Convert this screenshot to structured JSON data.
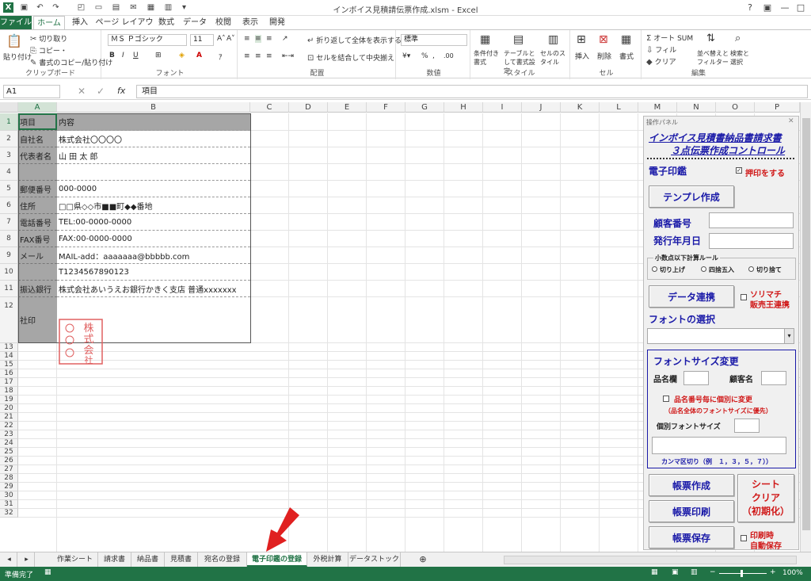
{
  "titlebar": {
    "title": "インボイス見積請伝票作成.xlsm - Excel",
    "help": "?",
    "min": "—",
    "max": "□",
    "close": "✕"
  },
  "tabs": [
    "ファイル",
    "ホーム",
    "挿入",
    "ページ レイアウト",
    "数式",
    "データ",
    "校閲",
    "表示",
    "開発"
  ],
  "ribbon": {
    "clipboard": {
      "paste": "貼り付け",
      "cut": "切り取り",
      "copy": "コピー・",
      "format_painter": "書式のコピー/貼り付け",
      "label": "クリップボード"
    },
    "font": {
      "name": "ＭＳ Ｐゴシック",
      "size": "11",
      "bold": "B",
      "italic": "I",
      "underline": "U",
      "label": "フォント"
    },
    "alignment": {
      "wrap": "折り返して全体を表示する",
      "merge": "セルを結合して中央揃え",
      "label": "配置"
    },
    "number": {
      "format": "標準",
      "percent": "%",
      "comma": ",",
      "label": "数値"
    },
    "styles": {
      "conditional": "条件付き書式",
      "table": "テーブルとして書式設定",
      "cell": "セルのスタイル",
      "label": "スタイル"
    },
    "cells": {
      "insert": "挿入",
      "delete": "削除",
      "format": "書式",
      "label": "セル"
    },
    "editing": {
      "autosum": "オート SUM",
      "fill": "フィル",
      "clear": "クリア",
      "sort": "並べ替えとフィルター",
      "find": "検索と選択",
      "label": "編集"
    }
  },
  "formula_bar": {
    "name_box": "A1",
    "fx": "fx",
    "value": "項目"
  },
  "columns": [
    "A",
    "B",
    "C",
    "D",
    "E",
    "F",
    "G",
    "H",
    "I",
    "J",
    "K",
    "L",
    "M",
    "N",
    "O",
    "P"
  ],
  "rows": [
    "1",
    "2",
    "3",
    "4",
    "5",
    "6",
    "7",
    "8",
    "9",
    "10",
    "11",
    "12",
    "13",
    "14",
    "15",
    "16",
    "17",
    "18",
    "19",
    "20",
    "21",
    "22",
    "23",
    "24",
    "25",
    "26",
    "27",
    "28",
    "29",
    "30",
    "31",
    "32"
  ],
  "table": [
    {
      "a": "項目",
      "b": "内容"
    },
    {
      "a": "自社名",
      "b": "株式会社〇〇〇〇"
    },
    {
      "a": "代表者名",
      "b": "山 田 太 郎"
    },
    {
      "a": "",
      "b": ""
    },
    {
      "a": "郵便番号",
      "b": "000-0000"
    },
    {
      "a": "住所",
      "b": "□□県◇◇市■■町◆◆番地"
    },
    {
      "a": "電話番号",
      "b": "TEL:00-0000-0000"
    },
    {
      "a": "FAX番号",
      "b": "FAX:00-0000-0000"
    },
    {
      "a": "メール",
      "b": "MAIL-add：aaaaaaa@bbbbb.com"
    },
    {
      "a": "",
      "b": "T1234567890123"
    },
    {
      "a": "振込銀行",
      "b": "株式会社あいうえお銀行かきく支店  普通xxxxxxx"
    },
    {
      "a": "社印",
      "b": ""
    }
  ],
  "stamp": {
    "text": "株式会社",
    "color": "#e06060"
  },
  "panel": {
    "title": "操作パネル",
    "close": "✕",
    "heading1": "インボイス見積書納品書請求書",
    "heading2": "３点伝票作成コントロール",
    "seal_label": "電子印鑑",
    "seal_check": "押印をする",
    "template_btn": "テンプレ作成",
    "customer_no": "顧客番号",
    "issue_date": "発行年月日",
    "rounding_title": "小数点以下計算ルール",
    "round_up": "切り上げ",
    "round_half": "四捨五入",
    "round_down": "切り捨て",
    "data_link_btn": "データ連携",
    "sorimachi_1": "ソリマチ",
    "sorimachi_2": "販売王連携",
    "font_select": "フォントの選択",
    "font_size_title": "フォントサイズ変更",
    "item_col": "品名欄",
    "customer_name": "顧客名",
    "individual_change": "品名番号毎に個別に変更",
    "individual_note": "（品名全体のフォントサイズに優先）",
    "individual_size": "個別フォントサイズ",
    "comma_note": "カンマ区切り（例　１，３，５，７））",
    "create_btn": "帳票作成",
    "print_btn": "帳票印刷",
    "save_btn": "帳票保存",
    "sheet_clear_1": "シート",
    "sheet_clear_2": "クリア",
    "sheet_clear_3": "（初期化）",
    "print_auto_1": "印刷時",
    "print_auto_2": "自動保存"
  },
  "sheet_tabs": [
    "作業シート",
    "請求書",
    "納品書",
    "見積書",
    "宛名の登録",
    "電子印鑑の登録",
    "外税計算",
    "データストック"
  ],
  "active_sheet": "電子印鑑の登録",
  "status": {
    "ready": "準備完了",
    "zoom": "100%"
  },
  "colors": {
    "excel_green": "#217346",
    "header_gray": "#a6a6a6",
    "panel_blue": "#1a1aa8",
    "red": "#d01818",
    "arrow_red": "#e02020"
  }
}
